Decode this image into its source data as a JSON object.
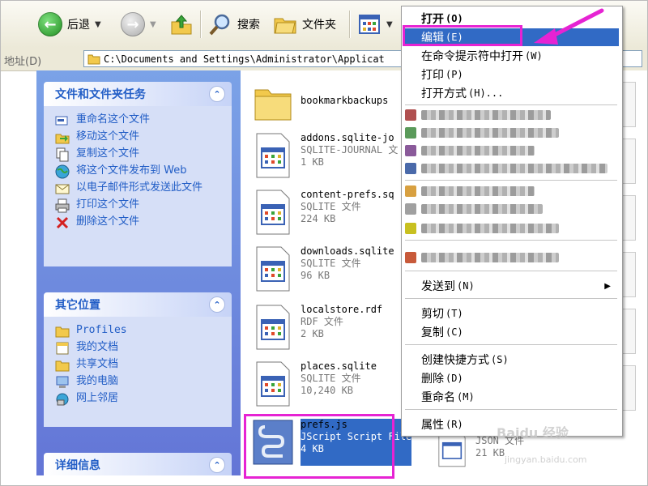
{
  "toolbar": {
    "back_label": "后退",
    "search_label": "搜索",
    "folders_label": "文件夹"
  },
  "address": {
    "label": "地址(D)",
    "path": "C:\\Documents and Settings\\Administrator\\Applicat"
  },
  "tasks_panel": {
    "title": "文件和文件夹任务",
    "items": [
      {
        "label": "重命名这个文件",
        "icon": "rename-icon"
      },
      {
        "label": "移动这个文件",
        "icon": "move-icon"
      },
      {
        "label": "复制这个文件",
        "icon": "copy-icon"
      },
      {
        "label": "将这个文件发布到 Web",
        "icon": "publish-web-icon"
      },
      {
        "label": "以电子邮件形式发送此文件",
        "icon": "email-icon"
      },
      {
        "label": "打印这个文件",
        "icon": "print-icon"
      },
      {
        "label": "删除这个文件",
        "icon": "delete-icon"
      }
    ]
  },
  "places_panel": {
    "title": "其它位置",
    "items": [
      {
        "label": "Profiles",
        "icon": "folder-icon"
      },
      {
        "label": "我的文档",
        "icon": "my-documents-icon"
      },
      {
        "label": "共享文档",
        "icon": "folder-icon"
      },
      {
        "label": "我的电脑",
        "icon": "my-computer-icon"
      },
      {
        "label": "网上邻居",
        "icon": "network-icon"
      }
    ]
  },
  "details_panel": {
    "title": "详细信息"
  },
  "files": [
    {
      "name": "bookmarkbackups",
      "type": "",
      "size": "",
      "icon": "folder-icon"
    },
    {
      "name": "addons.sqlite-jo",
      "type": "SQLITE-JOURNAL 文",
      "size": "1 KB",
      "icon": "file-icon"
    },
    {
      "name": "content-prefs.sq",
      "type": "SQLITE 文件",
      "size": "224 KB",
      "icon": "file-icon"
    },
    {
      "name": "downloads.sqlite",
      "type": "SQLITE 文件",
      "size": "96 KB",
      "icon": "file-icon"
    },
    {
      "name": "localstore.rdf",
      "type": "RDF 文件",
      "size": "2 KB",
      "icon": "file-icon"
    },
    {
      "name": "places.sqlite",
      "type": "SQLITE 文件",
      "size": "10,240 KB",
      "icon": "file-icon"
    },
    {
      "name": "prefs.js",
      "type": "JScript Script File",
      "size": "4 KB",
      "icon": "script-icon",
      "selected": true
    }
  ],
  "partial_file": {
    "type": "JSON 文件",
    "size": "21 KB"
  },
  "context_menu": {
    "open": {
      "label": "打开",
      "key": "(O)"
    },
    "edit": {
      "label": "编辑",
      "key": "(E)"
    },
    "cmd_open": {
      "label": "在命令提示符中打开",
      "key": "(W)"
    },
    "print": {
      "label": "打印",
      "key": "(P)"
    },
    "open_with": {
      "label": "打开方式",
      "key": "(H)..."
    },
    "send_to": {
      "label": "发送到",
      "key": "(N)"
    },
    "cut": {
      "label": "剪切",
      "key": "(T)"
    },
    "copy": {
      "label": "复制",
      "key": "(C)"
    },
    "shortcut": {
      "label": "创建快捷方式",
      "key": "(S)"
    },
    "delete": {
      "label": "删除",
      "key": "(D)"
    },
    "rename": {
      "label": "重命名",
      "key": "(M)"
    },
    "properties": {
      "label": "属性",
      "key": "(R)"
    }
  },
  "watermark": {
    "text": "Baidu 经验",
    "url": "jingyan.baidu.com"
  },
  "colors": {
    "highlight": "#316ac5",
    "annotation": "#e623d3",
    "panel_link": "#215dc6"
  }
}
